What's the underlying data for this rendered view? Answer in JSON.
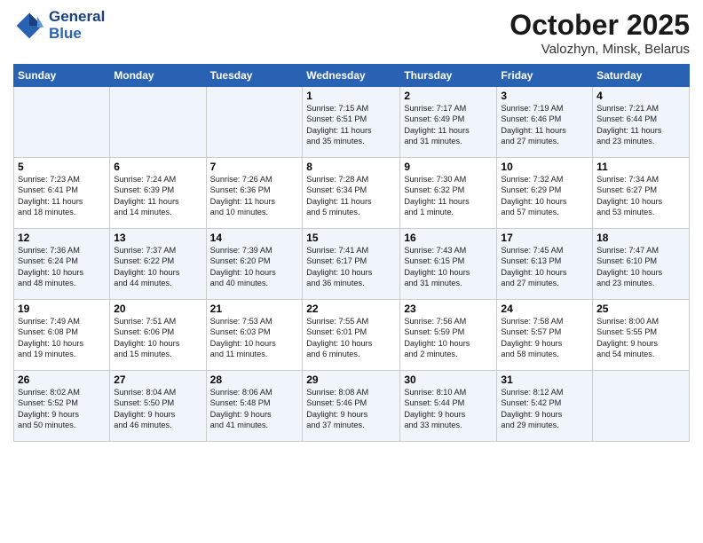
{
  "header": {
    "logo_line1": "General",
    "logo_line2": "Blue",
    "month": "October 2025",
    "location": "Valozhyn, Minsk, Belarus"
  },
  "weekdays": [
    "Sunday",
    "Monday",
    "Tuesday",
    "Wednesday",
    "Thursday",
    "Friday",
    "Saturday"
  ],
  "weeks": [
    [
      {
        "day": "",
        "info": ""
      },
      {
        "day": "",
        "info": ""
      },
      {
        "day": "",
        "info": ""
      },
      {
        "day": "1",
        "info": "Sunrise: 7:15 AM\nSunset: 6:51 PM\nDaylight: 11 hours\nand 35 minutes."
      },
      {
        "day": "2",
        "info": "Sunrise: 7:17 AM\nSunset: 6:49 PM\nDaylight: 11 hours\nand 31 minutes."
      },
      {
        "day": "3",
        "info": "Sunrise: 7:19 AM\nSunset: 6:46 PM\nDaylight: 11 hours\nand 27 minutes."
      },
      {
        "day": "4",
        "info": "Sunrise: 7:21 AM\nSunset: 6:44 PM\nDaylight: 11 hours\nand 23 minutes."
      }
    ],
    [
      {
        "day": "5",
        "info": "Sunrise: 7:23 AM\nSunset: 6:41 PM\nDaylight: 11 hours\nand 18 minutes."
      },
      {
        "day": "6",
        "info": "Sunrise: 7:24 AM\nSunset: 6:39 PM\nDaylight: 11 hours\nand 14 minutes."
      },
      {
        "day": "7",
        "info": "Sunrise: 7:26 AM\nSunset: 6:36 PM\nDaylight: 11 hours\nand 10 minutes."
      },
      {
        "day": "8",
        "info": "Sunrise: 7:28 AM\nSunset: 6:34 PM\nDaylight: 11 hours\nand 5 minutes."
      },
      {
        "day": "9",
        "info": "Sunrise: 7:30 AM\nSunset: 6:32 PM\nDaylight: 11 hours\nand 1 minute."
      },
      {
        "day": "10",
        "info": "Sunrise: 7:32 AM\nSunset: 6:29 PM\nDaylight: 10 hours\nand 57 minutes."
      },
      {
        "day": "11",
        "info": "Sunrise: 7:34 AM\nSunset: 6:27 PM\nDaylight: 10 hours\nand 53 minutes."
      }
    ],
    [
      {
        "day": "12",
        "info": "Sunrise: 7:36 AM\nSunset: 6:24 PM\nDaylight: 10 hours\nand 48 minutes."
      },
      {
        "day": "13",
        "info": "Sunrise: 7:37 AM\nSunset: 6:22 PM\nDaylight: 10 hours\nand 44 minutes."
      },
      {
        "day": "14",
        "info": "Sunrise: 7:39 AM\nSunset: 6:20 PM\nDaylight: 10 hours\nand 40 minutes."
      },
      {
        "day": "15",
        "info": "Sunrise: 7:41 AM\nSunset: 6:17 PM\nDaylight: 10 hours\nand 36 minutes."
      },
      {
        "day": "16",
        "info": "Sunrise: 7:43 AM\nSunset: 6:15 PM\nDaylight: 10 hours\nand 31 minutes."
      },
      {
        "day": "17",
        "info": "Sunrise: 7:45 AM\nSunset: 6:13 PM\nDaylight: 10 hours\nand 27 minutes."
      },
      {
        "day": "18",
        "info": "Sunrise: 7:47 AM\nSunset: 6:10 PM\nDaylight: 10 hours\nand 23 minutes."
      }
    ],
    [
      {
        "day": "19",
        "info": "Sunrise: 7:49 AM\nSunset: 6:08 PM\nDaylight: 10 hours\nand 19 minutes."
      },
      {
        "day": "20",
        "info": "Sunrise: 7:51 AM\nSunset: 6:06 PM\nDaylight: 10 hours\nand 15 minutes."
      },
      {
        "day": "21",
        "info": "Sunrise: 7:53 AM\nSunset: 6:03 PM\nDaylight: 10 hours\nand 11 minutes."
      },
      {
        "day": "22",
        "info": "Sunrise: 7:55 AM\nSunset: 6:01 PM\nDaylight: 10 hours\nand 6 minutes."
      },
      {
        "day": "23",
        "info": "Sunrise: 7:56 AM\nSunset: 5:59 PM\nDaylight: 10 hours\nand 2 minutes."
      },
      {
        "day": "24",
        "info": "Sunrise: 7:58 AM\nSunset: 5:57 PM\nDaylight: 9 hours\nand 58 minutes."
      },
      {
        "day": "25",
        "info": "Sunrise: 8:00 AM\nSunset: 5:55 PM\nDaylight: 9 hours\nand 54 minutes."
      }
    ],
    [
      {
        "day": "26",
        "info": "Sunrise: 8:02 AM\nSunset: 5:52 PM\nDaylight: 9 hours\nand 50 minutes."
      },
      {
        "day": "27",
        "info": "Sunrise: 8:04 AM\nSunset: 5:50 PM\nDaylight: 9 hours\nand 46 minutes."
      },
      {
        "day": "28",
        "info": "Sunrise: 8:06 AM\nSunset: 5:48 PM\nDaylight: 9 hours\nand 41 minutes."
      },
      {
        "day": "29",
        "info": "Sunrise: 8:08 AM\nSunset: 5:46 PM\nDaylight: 9 hours\nand 37 minutes."
      },
      {
        "day": "30",
        "info": "Sunrise: 8:10 AM\nSunset: 5:44 PM\nDaylight: 9 hours\nand 33 minutes."
      },
      {
        "day": "31",
        "info": "Sunrise: 8:12 AM\nSunset: 5:42 PM\nDaylight: 9 hours\nand 29 minutes."
      },
      {
        "day": "",
        "info": ""
      }
    ]
  ]
}
